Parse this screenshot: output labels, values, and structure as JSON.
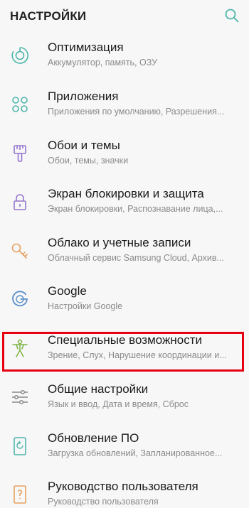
{
  "header": {
    "title": "НАСТРОЙКИ",
    "search_icon": "search-icon"
  },
  "colors": {
    "background": "#f7f7f7",
    "highlight": "#e60012",
    "icon_teal": "#4db6ac",
    "icon_purple": "#9575cd",
    "icon_orange": "#e8a060",
    "icon_green": "#7cb342",
    "icon_blue": "#5c8fc8"
  },
  "items": [
    {
      "icon": "optimization-icon",
      "title": "Оптимизация",
      "subtitle": "Аккумулятор, память, ОЗУ"
    },
    {
      "icon": "apps-icon",
      "title": "Приложения",
      "subtitle": "Приложения по умолчанию, Разрешения..."
    },
    {
      "icon": "brush-icon",
      "title": "Обои и темы",
      "subtitle": "Обои, темы, значки"
    },
    {
      "icon": "lock-icon",
      "title": "Экран блокировки и защита",
      "subtitle": "Экран блокировки, Распознавание лица,..."
    },
    {
      "icon": "key-icon",
      "title": "Облако и учетные записи",
      "subtitle": "Облачный сервис Samsung Cloud, Архив..."
    },
    {
      "icon": "google-icon",
      "title": "Google",
      "subtitle": "Настройки Google"
    },
    {
      "icon": "accessibility-icon",
      "title": "Специальные возможности",
      "subtitle": "Зрение, Слух, Нарушение координации и..."
    },
    {
      "icon": "sliders-icon",
      "title": "Общие настройки",
      "subtitle": "Язык и ввод, Дата и время, Сброс"
    },
    {
      "icon": "update-icon",
      "title": "Обновление ПО",
      "subtitle": "Загрузка обновлений, Запланированное..."
    },
    {
      "icon": "manual-icon",
      "title": "Руководство пользователя",
      "subtitle": "Руководство пользователя"
    }
  ]
}
